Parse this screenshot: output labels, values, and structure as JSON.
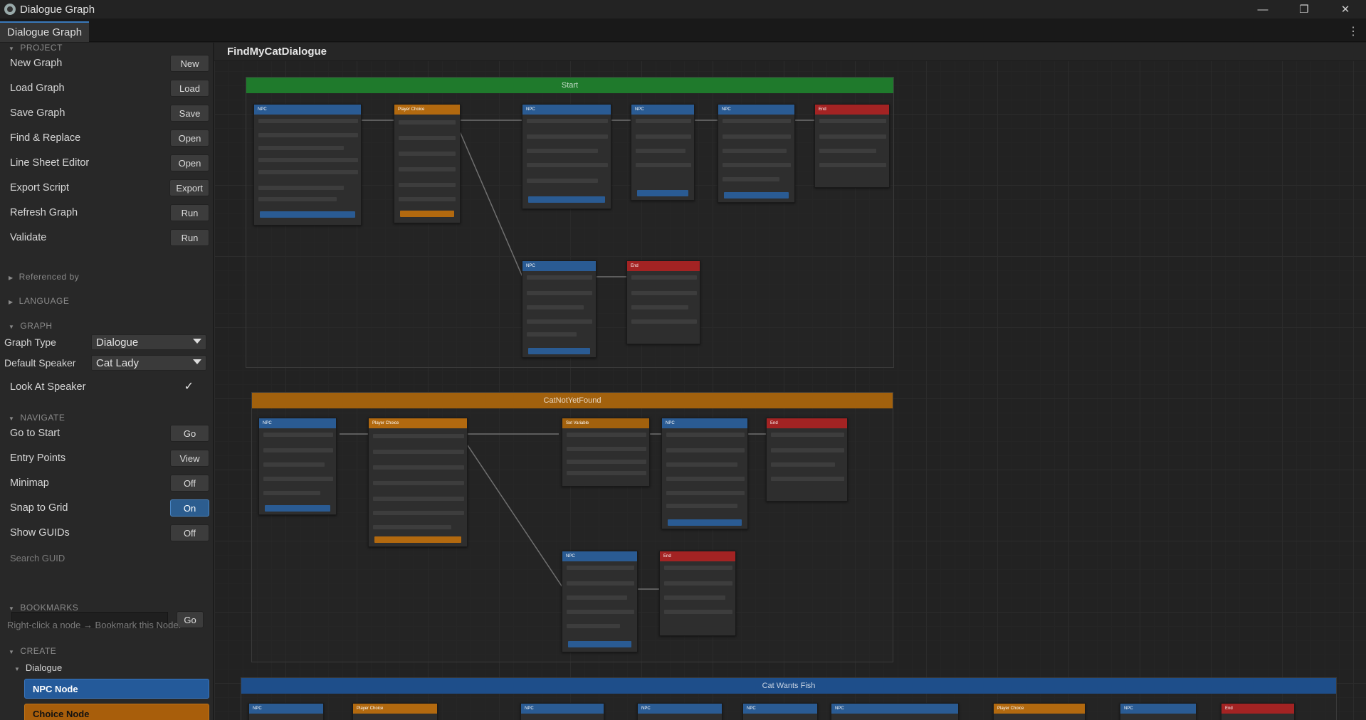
{
  "window": {
    "title": "Dialogue Graph",
    "tab": "Dialogue Graph",
    "controls": [
      "—",
      "❐",
      "✕"
    ],
    "menu": "⋮"
  },
  "sidebar": {
    "project": {
      "header": "PROJECT",
      "items": [
        {
          "label": "New Graph",
          "button": "New"
        },
        {
          "label": "Load Graph",
          "button": "Load"
        },
        {
          "label": "Save Graph",
          "button": "Save"
        },
        {
          "label": "Find & Replace",
          "button": "Open"
        },
        {
          "label": "Line Sheet Editor",
          "button": "Open"
        },
        {
          "label": "Export Script",
          "button": "Export"
        },
        {
          "label": "Refresh Graph",
          "button": "Run"
        },
        {
          "label": "Validate",
          "button": "Run"
        }
      ]
    },
    "referenced_by": "Referenced by",
    "language": "LANGUAGE",
    "graph": {
      "header": "GRAPH",
      "graph_type_label": "Graph Type",
      "graph_type_value": "Dialogue",
      "default_speaker_label": "Default Speaker",
      "default_speaker_value": "Cat Lady",
      "look_at_speaker_label": "Look At Speaker",
      "look_at_speaker_check": "✓"
    },
    "navigate": {
      "header": "NAVIGATE",
      "items": [
        {
          "label": "Go to Start",
          "button": "Go"
        },
        {
          "label": "Entry Points",
          "button": "View"
        },
        {
          "label": "Minimap",
          "button": "Off"
        },
        {
          "label": "Snap to Grid",
          "button": "On"
        },
        {
          "label": "Show GUIDs",
          "button": "Off"
        }
      ],
      "search_guid_label": "Search GUID",
      "search_guid_button": "Go"
    },
    "bookmarks": {
      "header": "BOOKMARKS",
      "hint": "Right-click a node → Bookmark this Node."
    },
    "create": {
      "header": "CREATE",
      "sub": "Dialogue",
      "npc_node": "NPC Node",
      "choice_node": "Choice Node"
    }
  },
  "canvas": {
    "graph_name": "FindMyCatDialogue",
    "groups": [
      "Start",
      "CatNotYetFound",
      "Cat Wants Fish"
    ],
    "node_titles": {
      "npc": "NPC",
      "player": "Player Choice",
      "end": "End",
      "set_variable": "Set Variable"
    },
    "colors": {
      "npc": "#2a5b93",
      "player": "#b2690f",
      "end": "#a32323",
      "start_group": "#1f7a2c",
      "cnyf_group": "#a2610d",
      "cwf_group": "#1e4e8a"
    }
  }
}
